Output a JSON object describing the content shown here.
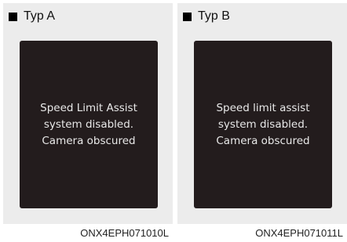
{
  "panels": [
    {
      "label": "Typ A",
      "message": [
        "Speed Limit Assist",
        "system disabled.",
        "Camera obscured"
      ],
      "code": "ONX4EPH071010L"
    },
    {
      "label": "Typ B",
      "message": [
        "Speed limit assist",
        "system disabled.",
        "Camera obscured"
      ],
      "code": "ONX4EPH071011L"
    }
  ],
  "colors": {
    "panel_background": "#ececec",
    "screen_background": "#231c1d",
    "screen_text": "#e8e8e8"
  },
  "icons": [
    "black-square-bullet"
  ]
}
